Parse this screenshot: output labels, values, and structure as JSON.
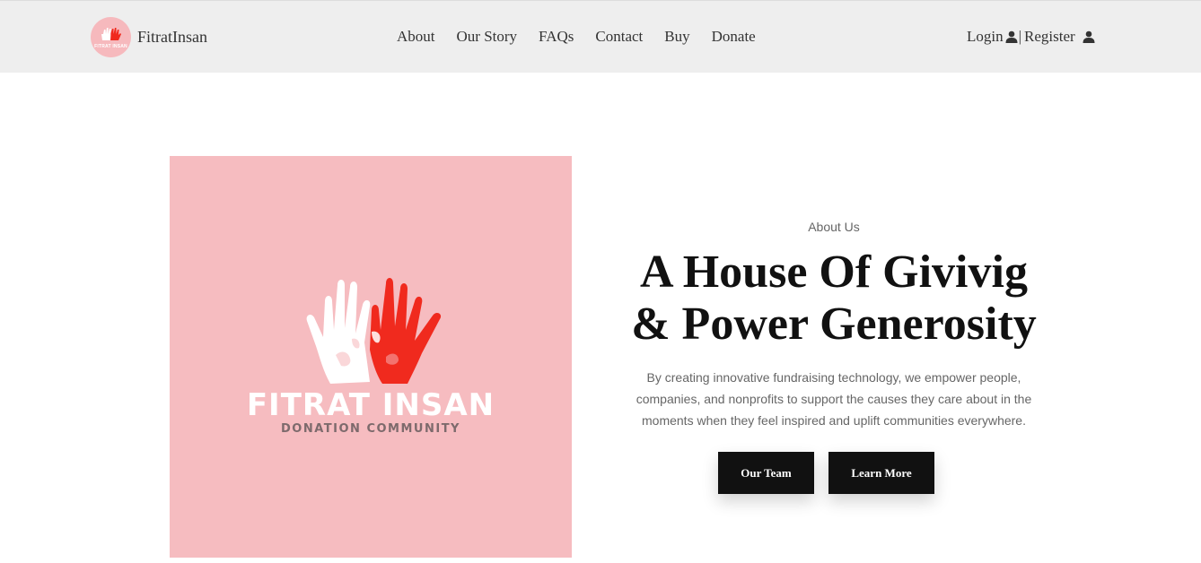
{
  "nav": {
    "brand_name": "FitratInsan",
    "brand_logo_text": "FITRAT INSAN",
    "links": [
      "About",
      "Our Story",
      "FAQs",
      "Contact",
      "Buy",
      "Donate"
    ],
    "login_label": "Login",
    "separator": "|",
    "register_label": "Register",
    "icons": {
      "user": "user-icon"
    }
  },
  "hero_image": {
    "title": "FITRAT INSAN",
    "subtitle": "DONATION COMMUNITY",
    "colors": {
      "background": "#f6bcc0",
      "hand_white": "#ffffff",
      "hand_red": "#f02a1e"
    }
  },
  "about": {
    "label": "About Us",
    "heading_line1": "A House Of Givivig",
    "heading_line2": "& Power Generosity",
    "description": "By creating innovative fundraising technology, we empower people, companies, and nonprofits to support the causes they care about in the moments when they feel inspired and uplift communities everywhere.",
    "buttons": {
      "team": "Our Team",
      "learn": "Learn More"
    }
  }
}
